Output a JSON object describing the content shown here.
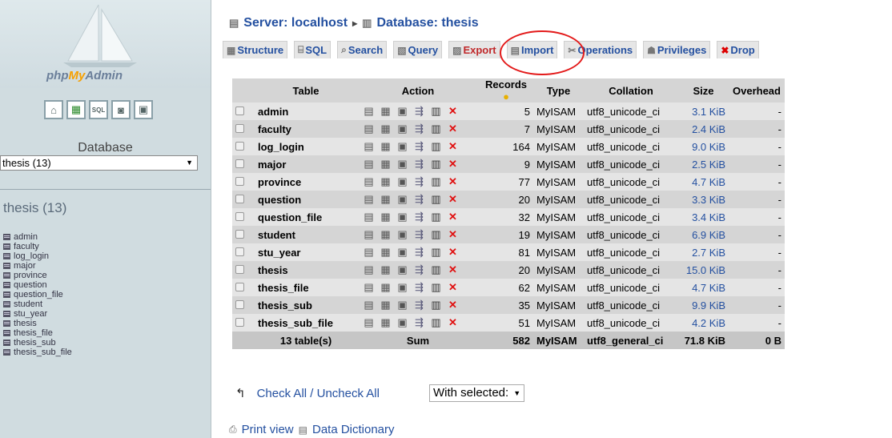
{
  "app": {
    "logo_text_pre": "php",
    "logo_text_my": "My",
    "logo_text_post": "Admin"
  },
  "left": {
    "icons": [
      "home-icon",
      "sql-query-icon",
      "sql-window-icon",
      "docs-icon",
      "docs-window-icon"
    ],
    "database_label": "Database",
    "database_select": "thesis (13)",
    "database_heading": "thesis (13)",
    "tables": [
      "admin",
      "faculty",
      "log_login",
      "major",
      "province",
      "question",
      "question_file",
      "student",
      "stu_year",
      "thesis",
      "thesis_file",
      "thesis_sub",
      "thesis_sub_file"
    ]
  },
  "breadcrumb": {
    "server": "Server: localhost",
    "separator": "▸",
    "database": "Database: thesis"
  },
  "tabs": [
    {
      "label": "Structure",
      "icon": "structure-icon"
    },
    {
      "label": "SQL",
      "icon": "sql-icon"
    },
    {
      "label": "Search",
      "icon": "search-icon"
    },
    {
      "label": "Query",
      "icon": "query-icon"
    },
    {
      "label": "Export",
      "icon": "export-icon"
    },
    {
      "label": "Import",
      "icon": "import-icon"
    },
    {
      "label": "Operations",
      "icon": "operations-icon"
    },
    {
      "label": "Privileges",
      "icon": "privileges-icon"
    },
    {
      "label": "Drop",
      "icon": "drop-icon"
    }
  ],
  "table_headers": {
    "table": "Table",
    "action": "Action",
    "records": "Records",
    "type": "Type",
    "collation": "Collation",
    "size": "Size",
    "overhead": "Overhead"
  },
  "rows": [
    {
      "name": "admin",
      "records": "5",
      "type": "MyISAM",
      "collation": "utf8_unicode_ci",
      "size": "3.1 KiB",
      "overhead": "-"
    },
    {
      "name": "faculty",
      "records": "7",
      "type": "MyISAM",
      "collation": "utf8_unicode_ci",
      "size": "2.4 KiB",
      "overhead": "-"
    },
    {
      "name": "log_login",
      "records": "164",
      "type": "MyISAM",
      "collation": "utf8_unicode_ci",
      "size": "9.0 KiB",
      "overhead": "-"
    },
    {
      "name": "major",
      "records": "9",
      "type": "MyISAM",
      "collation": "utf8_unicode_ci",
      "size": "2.5 KiB",
      "overhead": "-"
    },
    {
      "name": "province",
      "records": "77",
      "type": "MyISAM",
      "collation": "utf8_unicode_ci",
      "size": "4.7 KiB",
      "overhead": "-"
    },
    {
      "name": "question",
      "records": "20",
      "type": "MyISAM",
      "collation": "utf8_unicode_ci",
      "size": "3.3 KiB",
      "overhead": "-"
    },
    {
      "name": "question_file",
      "records": "32",
      "type": "MyISAM",
      "collation": "utf8_unicode_ci",
      "size": "3.4 KiB",
      "overhead": "-"
    },
    {
      "name": "student",
      "records": "19",
      "type": "MyISAM",
      "collation": "utf8_unicode_ci",
      "size": "6.9 KiB",
      "overhead": "-"
    },
    {
      "name": "stu_year",
      "records": "81",
      "type": "MyISAM",
      "collation": "utf8_unicode_ci",
      "size": "2.7 KiB",
      "overhead": "-"
    },
    {
      "name": "thesis",
      "records": "20",
      "type": "MyISAM",
      "collation": "utf8_unicode_ci",
      "size": "15.0 KiB",
      "overhead": "-"
    },
    {
      "name": "thesis_file",
      "records": "62",
      "type": "MyISAM",
      "collation": "utf8_unicode_ci",
      "size": "4.7 KiB",
      "overhead": "-"
    },
    {
      "name": "thesis_sub",
      "records": "35",
      "type": "MyISAM",
      "collation": "utf8_unicode_ci",
      "size": "9.9 KiB",
      "overhead": "-"
    },
    {
      "name": "thesis_sub_file",
      "records": "51",
      "type": "MyISAM",
      "collation": "utf8_unicode_ci",
      "size": "4.2 KiB",
      "overhead": "-"
    }
  ],
  "summary": {
    "tables": "13 table(s)",
    "sum_label": "Sum",
    "records": "582",
    "type": "MyISAM",
    "collation": "utf8_general_ci",
    "size": "71.8 KiB",
    "overhead": "0 B"
  },
  "bottom": {
    "check_all": "Check All / Uncheck All",
    "with_selected": "With selected:",
    "print_view": "Print view",
    "data_dictionary": "Data Dictionary"
  },
  "colors": {
    "link": "#2450a0",
    "delete": "#e01010",
    "annotation_circle": "#e31a1a",
    "left_panel": "#d0dce0"
  }
}
